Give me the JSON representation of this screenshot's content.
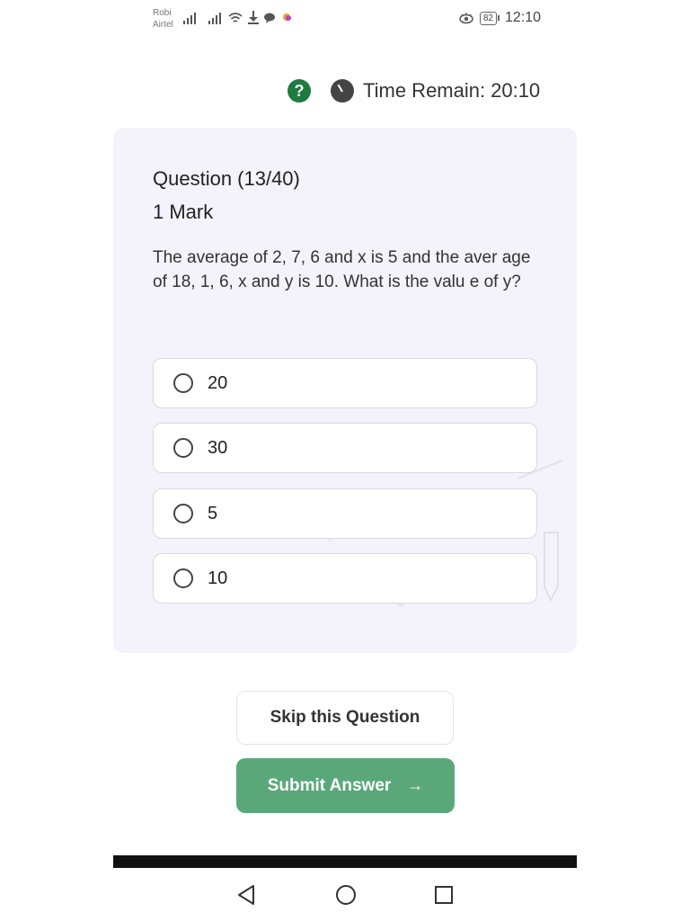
{
  "status_bar": {
    "carrier_1": "Robi",
    "carrier_2": "Airtel",
    "battery": "82",
    "time": "12:10"
  },
  "timer": {
    "label": "Time Remain:",
    "value": "20:10"
  },
  "question": {
    "title": "Question (13/40)",
    "marks": "1 Mark",
    "text": "The average of 2, 7, 6 and x is 5 and the aver age of 18, 1, 6, x and y is 10. What is the valu e of y?",
    "options": [
      {
        "label": "20"
      },
      {
        "label": "30"
      },
      {
        "label": "5"
      },
      {
        "label": "10"
      }
    ]
  },
  "actions": {
    "skip_label": "Skip this Question",
    "submit_label": "Submit Answer",
    "submit_arrow": "→"
  },
  "colors": {
    "accent_green": "#5aa87a",
    "help_green": "#1f7a3f",
    "card_bg": "#f4f3fb"
  },
  "icons": {
    "help": "help-icon",
    "clock": "clock-icon",
    "nav_back": "back-triangle-icon",
    "nav_home": "home-circle-icon",
    "nav_recent": "recent-square-icon"
  }
}
